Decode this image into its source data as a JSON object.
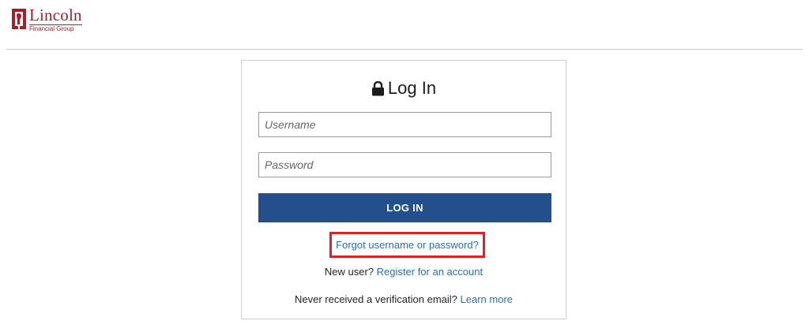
{
  "logo": {
    "name": "Lincoln",
    "subtitle": "Financial Group",
    "color": "#a51f2b"
  },
  "login": {
    "title": "Log In",
    "lock_icon": "lock-icon",
    "username_placeholder": "Username",
    "username_value": "",
    "password_placeholder": "Password",
    "password_value": "",
    "button_label": "LOG IN",
    "button_color": "#244f8d",
    "forgot_link": "Forgot username or password?",
    "highlight_color": "#e0202b",
    "new_user_prefix": "New user?",
    "register_link": "Register for an account",
    "verify_prefix": "Never received a verification email?",
    "learn_more_link": "Learn more",
    "link_color": "#2a6fb0"
  }
}
